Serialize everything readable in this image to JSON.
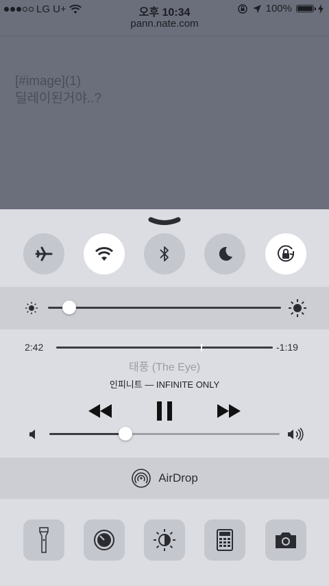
{
  "status_bar": {
    "carrier": "LG U+",
    "signal_bars_filled": 3,
    "signal_bars_total": 5,
    "time": "오후 10:34",
    "battery": "100%",
    "battery_level": 1.0
  },
  "background_page": {
    "url": "pann.nate.com",
    "line1": "[#image](1)",
    "line2": "딜레이된거야..?"
  },
  "control_center": {
    "toggles": [
      {
        "icon": "airplane-icon",
        "on": false
      },
      {
        "icon": "wifi-icon",
        "on": true
      },
      {
        "icon": "bluetooth-icon",
        "on": false
      },
      {
        "icon": "moon-icon",
        "on": false
      },
      {
        "icon": "rotation-lock-icon",
        "on": true
      }
    ],
    "brightness_level": 0.09,
    "music": {
      "elapsed": "2:42",
      "remaining": "-1:19",
      "progress": 0.67,
      "title": "태풍 (The Eye)",
      "artist": "인피니트 — INFINITE ONLY"
    },
    "volume_level": 0.33,
    "airdrop_label": "AirDrop",
    "shortcuts": [
      "flashlight-icon",
      "timer-icon",
      "night-shift-icon",
      "calculator-icon",
      "camera-icon"
    ]
  }
}
